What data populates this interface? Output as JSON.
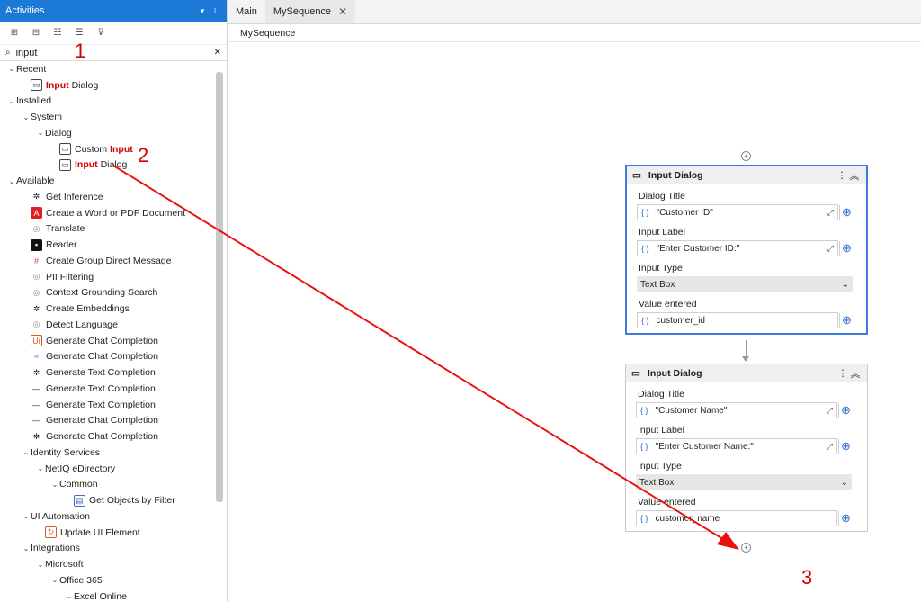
{
  "left_panel": {
    "title": "Activities",
    "search_value": "input"
  },
  "tree": [
    {
      "depth": 0,
      "caret": "v",
      "label": "Recent",
      "icon": ""
    },
    {
      "depth": 1,
      "caret": "",
      "bold": "Input",
      "rest": " Dialog",
      "icon": "dialog-icon"
    },
    {
      "depth": 0,
      "caret": "v",
      "label": "Installed",
      "icon": ""
    },
    {
      "depth": 1,
      "caret": "v",
      "label": "System",
      "icon": ""
    },
    {
      "depth": 2,
      "caret": "v",
      "label": "Dialog",
      "icon": ""
    },
    {
      "depth": 3,
      "caret": "",
      "pre": "Custom ",
      "bold": "Input",
      "icon": "custom-input-icon"
    },
    {
      "depth": 3,
      "caret": "",
      "bold": "Input",
      "rest": " Dialog",
      "icon": "dialog-icon"
    },
    {
      "depth": 0,
      "caret": "v",
      "label": "Available",
      "icon": ""
    },
    {
      "depth": 1,
      "caret": "",
      "label": "Get Inference",
      "icon": "openai-icon"
    },
    {
      "depth": 1,
      "caret": "",
      "label": "Create a Word or PDF Document",
      "icon": "pdf-icon"
    },
    {
      "depth": 1,
      "caret": "",
      "label": "Translate",
      "icon": "globe-icon"
    },
    {
      "depth": 1,
      "caret": "",
      "label": "Reader",
      "icon": "reader-icon"
    },
    {
      "depth": 1,
      "caret": "",
      "label": "Create Group Direct Message",
      "icon": "slack-icon"
    },
    {
      "depth": 1,
      "caret": "",
      "label": "PII Filtering",
      "icon": "globe-icon"
    },
    {
      "depth": 1,
      "caret": "",
      "label": "Context Grounding Search",
      "icon": "globe-icon"
    },
    {
      "depth": 1,
      "caret": "",
      "label": "Create Embeddings",
      "icon": "openai-icon"
    },
    {
      "depth": 1,
      "caret": "",
      "label": "Detect Language",
      "icon": "globe-icon"
    },
    {
      "depth": 1,
      "caret": "",
      "label": "Generate Chat Completion",
      "icon": "uipath-icon"
    },
    {
      "depth": 1,
      "caret": "",
      "label": "Generate Chat Completion",
      "icon": "claude-icon"
    },
    {
      "depth": 1,
      "caret": "",
      "label": "Generate Text Completion",
      "icon": "openai-icon"
    },
    {
      "depth": 1,
      "caret": "",
      "label": "Generate Text Completion",
      "icon": "line-icon"
    },
    {
      "depth": 1,
      "caret": "",
      "label": "Generate Text Completion",
      "icon": "line-icon"
    },
    {
      "depth": 1,
      "caret": "",
      "label": "Generate Chat Completion",
      "icon": "line-icon"
    },
    {
      "depth": 1,
      "caret": "",
      "label": "Generate Chat Completion",
      "icon": "openai-icon"
    },
    {
      "depth": 1,
      "caret": "v",
      "label": "Identity Services",
      "icon": ""
    },
    {
      "depth": 2,
      "caret": "v",
      "label": "NetIQ eDirectory",
      "icon": ""
    },
    {
      "depth": 3,
      "caret": "v",
      "label": "Common",
      "icon": ""
    },
    {
      "depth": 4,
      "caret": "",
      "label": "Get Objects by Filter",
      "icon": "filter-objects-icon"
    },
    {
      "depth": 1,
      "caret": "v",
      "label": "UI Automation",
      "icon": ""
    },
    {
      "depth": 2,
      "caret": "",
      "label": "Update UI Element",
      "icon": "update-ui-icon"
    },
    {
      "depth": 1,
      "caret": "v",
      "label": "Integrations",
      "icon": ""
    },
    {
      "depth": 2,
      "caret": "v",
      "label": "Microsoft",
      "icon": ""
    },
    {
      "depth": 3,
      "caret": "v",
      "label": "Office 365",
      "icon": ""
    },
    {
      "depth": 4,
      "caret": "v",
      "label": "Excel Online",
      "icon": ""
    }
  ],
  "tabs": [
    {
      "label": "Main"
    },
    {
      "label": "MySequence"
    }
  ],
  "breadcrumb": "MySequence",
  "cards": [
    {
      "title": "Input Dialog",
      "f1_label": "Dialog Title",
      "f1_value": "\"Customer ID\"",
      "f2_label": "Input Label",
      "f2_value": "\"Enter Customer ID:\"",
      "f3_label": "Input Type",
      "f3_value": "Text Box",
      "f4_label": "Value entered",
      "f4_value": "customer_id"
    },
    {
      "title": "Input Dialog",
      "f1_label": "Dialog Title",
      "f1_value": "\"Customer Name\"",
      "f2_label": "Input Label",
      "f2_value": "\"Enter Customer Name:\"",
      "f3_label": "Input Type",
      "f3_value": "Text Box",
      "f4_label": "Value entered",
      "f4_value": "customer_name"
    }
  ],
  "annotations": {
    "n1": "1",
    "n2": "2",
    "n3": "3"
  },
  "colors": {
    "accent": "#1c7ad6",
    "highlight": "#d50000",
    "selected": "#3d7be0"
  }
}
